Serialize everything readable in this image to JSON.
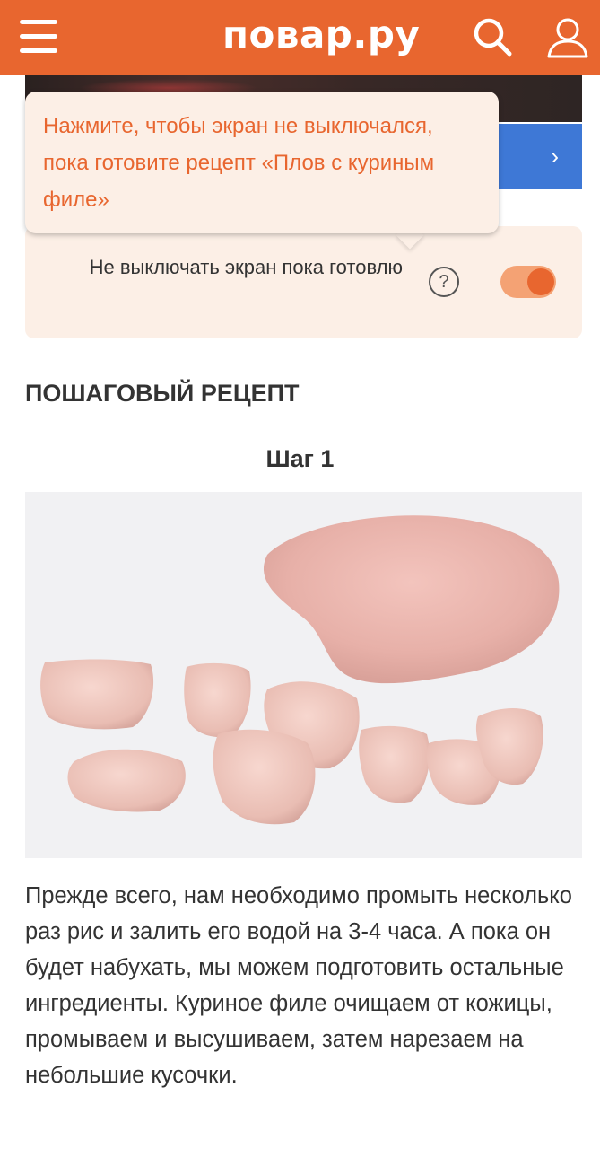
{
  "header": {
    "logo": "повар.ру",
    "background_color": "#e8662f",
    "icons": [
      "menu-icon",
      "search-icon",
      "user-icon"
    ]
  },
  "banner": {
    "arrow": "›",
    "color": "#3e78d6"
  },
  "tooltip": {
    "text": "Нажмите, чтобы экран не выключался, пока готовите рецепт «Плов с куриным филе»"
  },
  "keep_screen": {
    "label": "Не выключать экран пока готовлю",
    "help": "?",
    "toggle_on": true
  },
  "recipe": {
    "section_title": "ПОШАГОВЫЙ РЕЦЕПТ",
    "step_title": "Шаг 1",
    "step_text": "Прежде всего, нам необходимо промыть несколько раз рис и залить его водой на 3-4 часа. А пока он будет набухать, мы можем подготовить остальные ингредиенты. Куриное филе очищаем от кожицы, промываем и высушиваем, затем нарезаем на небольшие кусочки."
  }
}
